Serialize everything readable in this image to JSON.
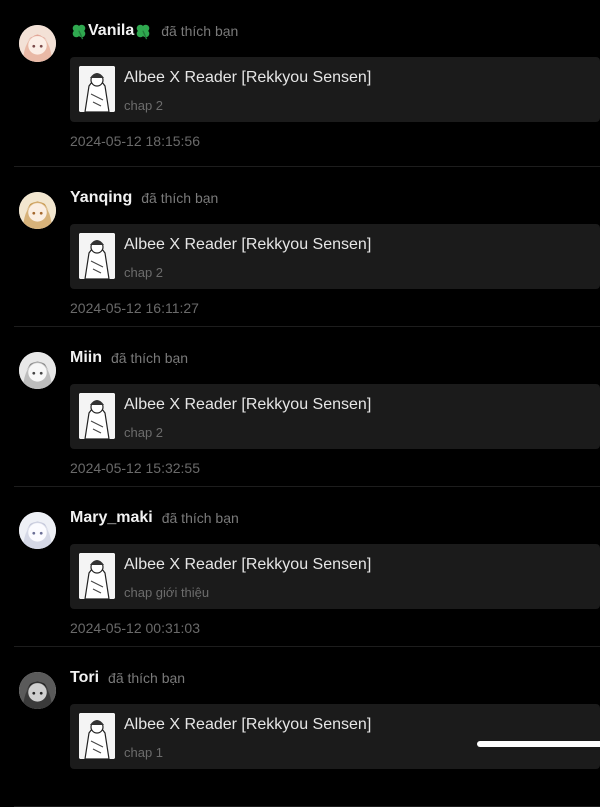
{
  "notifications": [
    {
      "user": "Vanila",
      "user_decoration": "four-leaf-clover-icon",
      "action": "đã thích bạn",
      "story_title": "Albee X Reader [Rekkyou Sensen]",
      "chapter": "chap 2",
      "time": "2024-05-12 18:15:56"
    },
    {
      "user": "Yanqing",
      "action": "đã thích bạn",
      "story_title": "Albee X Reader [Rekkyou Sensen]",
      "chapter": "chap 2",
      "time": "2024-05-12 16:11:27"
    },
    {
      "user": "Miin",
      "action": "đã thích bạn",
      "story_title": "Albee X Reader [Rekkyou Sensen]",
      "chapter": "chap 2",
      "time": "2024-05-12 15:32:55"
    },
    {
      "user": "Mary_maki",
      "action": "đã thích bạn",
      "story_title": "Albee X Reader [Rekkyou Sensen]",
      "chapter": "chap giới thiệu",
      "time": "2024-05-12 00:31:03"
    },
    {
      "user": "Tori",
      "action": "đã thích bạn",
      "story_title": "Albee X Reader [Rekkyou Sensen]",
      "chapter": "chap 1",
      "time": ""
    }
  ],
  "colors": {
    "background": "#000000",
    "card": "#1b1b1b",
    "muted_text": "#7a7a7a",
    "clover": "#2fa84f"
  }
}
